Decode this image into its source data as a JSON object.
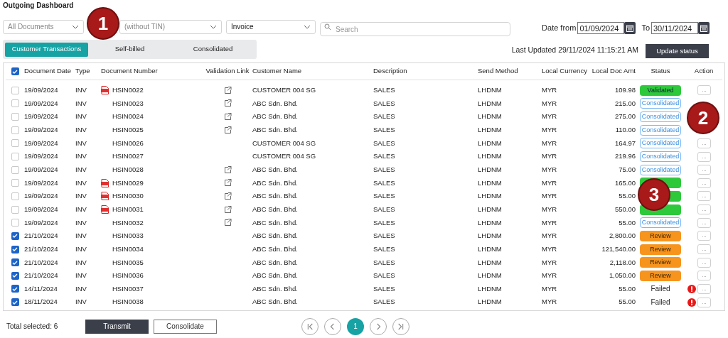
{
  "title": "Outgoing Dashboard",
  "filters": [
    {
      "kind": "dropdown",
      "value": "All Documents",
      "muted": true
    },
    {
      "kind": "dropdown",
      "value": "(without TIN)",
      "muted": true
    },
    {
      "kind": "dropdown",
      "value": "Invoice",
      "muted": false
    },
    {
      "kind": "search",
      "placeholder": "Search"
    }
  ],
  "date_from": {
    "label": "Date from",
    "value": "01/09/2024"
  },
  "date_to": {
    "label": "To",
    "value": "30/11/2024"
  },
  "tabs": [
    {
      "label": "Customer Transactions",
      "selected": true
    },
    {
      "label": "Self-billed",
      "selected": false
    },
    {
      "label": "Consolidated",
      "selected": false
    }
  ],
  "last_updated": "Last Updated 29/11/2024 11:15:21 AM",
  "update_button": "Update status",
  "table": {
    "all_checked": true,
    "columns": [
      "Document Date",
      "Type",
      "Document Number",
      "Validation Link",
      "Customer Name",
      "Description",
      "Send Method",
      "Local Currency",
      "Local Doc Amt",
      "Status",
      "Action"
    ],
    "rows": [
      {
        "checked": false,
        "date": "19/09/2024",
        "type": "INV",
        "pdf": true,
        "number": "HSIN0022",
        "link": true,
        "customer": "CUSTOMER 004 SG",
        "description": "SALES",
        "send": "LHDNM",
        "currency": "MYR",
        "amount": "109.98",
        "status": {
          "kind": "validated",
          "text": "Validated"
        },
        "error": false,
        "action": "..."
      },
      {
        "checked": false,
        "date": "19/09/2024",
        "type": "INV",
        "pdf": false,
        "number": "HSIN0023",
        "link": true,
        "customer": "ABC Sdn. Bhd.",
        "description": "SALES",
        "send": "LHDNM",
        "currency": "MYR",
        "amount": "215.00",
        "status": {
          "kind": "consolidated",
          "text": "Consolidated"
        },
        "error": false
      },
      {
        "checked": false,
        "date": "19/09/2024",
        "type": "INV",
        "pdf": false,
        "number": "HSIN0024",
        "link": true,
        "customer": "ABC Sdn. Bhd.",
        "description": "SALES",
        "send": "LHDNM",
        "currency": "MYR",
        "amount": "275.00",
        "status": {
          "kind": "consolidated",
          "text": "Consolidated"
        },
        "error": false
      },
      {
        "checked": false,
        "date": "19/09/2024",
        "type": "INV",
        "pdf": false,
        "number": "HSIN0025",
        "link": true,
        "customer": "ABC Sdn. Bhd.",
        "description": "SALES",
        "send": "LHDNM",
        "currency": "MYR",
        "amount": "110.00",
        "status": {
          "kind": "consolidated",
          "text": "Consolidated"
        },
        "error": false
      },
      {
        "checked": false,
        "date": "19/09/2024",
        "type": "INV",
        "pdf": false,
        "number": "HSIN0026",
        "link": false,
        "customer": "CUSTOMER 004 SG",
        "description": "SALES",
        "send": "LHDNM",
        "currency": "MYR",
        "amount": "164.97",
        "status": {
          "kind": "consolidated",
          "text": "Consolidated"
        },
        "error": false,
        "action": "..."
      },
      {
        "checked": false,
        "date": "19/09/2024",
        "type": "INV",
        "pdf": false,
        "number": "HSIN0027",
        "link": false,
        "customer": "CUSTOMER 004 SG",
        "description": "SALES",
        "send": "LHDNM",
        "currency": "MYR",
        "amount": "219.96",
        "status": {
          "kind": "consolidated",
          "text": "Consolidated"
        },
        "error": false,
        "action": "..."
      },
      {
        "checked": false,
        "date": "19/09/2024",
        "type": "INV",
        "pdf": false,
        "number": "HSIN0028",
        "link": true,
        "customer": "ABC Sdn. Bhd.",
        "description": "SALES",
        "send": "LHDNM",
        "currency": "MYR",
        "amount": "75.00",
        "status": {
          "kind": "consolidated",
          "text": "Consolidated"
        },
        "error": false,
        "action": "..."
      },
      {
        "checked": false,
        "date": "19/09/2024",
        "type": "INV",
        "pdf": true,
        "number": "HSIN0029",
        "link": true,
        "customer": "ABC Sdn. Bhd.",
        "description": "SALES",
        "send": "LHDNM",
        "currency": "MYR",
        "amount": "165.00",
        "status": {
          "kind": "validated"
        },
        "error": false,
        "action": "..."
      },
      {
        "checked": false,
        "date": "19/09/2024",
        "type": "INV",
        "pdf": true,
        "number": "HSIN0030",
        "link": true,
        "customer": "ABC Sdn. Bhd.",
        "description": "SALES",
        "send": "LHDNM",
        "currency": "MYR",
        "amount": "55.00",
        "status": {
          "kind": "validated"
        },
        "error": false,
        "action": "..."
      },
      {
        "checked": false,
        "date": "19/09/2024",
        "type": "INV",
        "pdf": true,
        "number": "HSIN0031",
        "link": true,
        "customer": "ABC Sdn. Bhd.",
        "description": "SALES",
        "send": "LHDNM",
        "currency": "MYR",
        "amount": "550.00",
        "status": {
          "kind": "validated"
        },
        "error": false,
        "action": "..."
      },
      {
        "checked": false,
        "date": "19/09/2024",
        "type": "INV",
        "pdf": false,
        "number": "HSIN0032",
        "link": true,
        "customer": "ABC Sdn. Bhd.",
        "description": "SALES",
        "send": "LHDNM",
        "currency": "MYR",
        "amount": "55.00",
        "status": {
          "kind": "consolidated",
          "text": "Consolidated"
        },
        "error": false,
        "action": "..."
      },
      {
        "checked": true,
        "date": "21/10/2024",
        "type": "INV",
        "pdf": false,
        "number": "HSIN0033",
        "link": false,
        "customer": "ABC Sdn. Bhd.",
        "description": "SALES",
        "send": "LHDNM",
        "currency": "MYR",
        "amount": "2,800.00",
        "status": {
          "kind": "review",
          "text": "Review"
        },
        "error": false,
        "action": "..."
      },
      {
        "checked": true,
        "date": "21/10/2024",
        "type": "INV",
        "pdf": false,
        "number": "HSIN0034",
        "link": false,
        "customer": "ABC Sdn. Bhd.",
        "description": "SALES",
        "send": "LHDNM",
        "currency": "MYR",
        "amount": "121,540.00",
        "status": {
          "kind": "review",
          "text": "Review"
        },
        "error": false,
        "action": "..."
      },
      {
        "checked": true,
        "date": "21/10/2024",
        "type": "INV",
        "pdf": false,
        "number": "HSIN0035",
        "link": false,
        "customer": "ABC Sdn. Bhd.",
        "description": "SALES",
        "send": "LHDNM",
        "currency": "MYR",
        "amount": "2,118.00",
        "status": {
          "kind": "review",
          "text": "Review"
        },
        "error": false,
        "action": "..."
      },
      {
        "checked": true,
        "date": "21/10/2024",
        "type": "INV",
        "pdf": false,
        "number": "HSIN0036",
        "link": false,
        "customer": "ABC Sdn. Bhd.",
        "description": "SALES",
        "send": "LHDNM",
        "currency": "MYR",
        "amount": "1,050.00",
        "status": {
          "kind": "review",
          "text": "Review"
        },
        "error": false,
        "action": "..."
      },
      {
        "checked": true,
        "date": "14/11/2024",
        "type": "INV",
        "pdf": false,
        "number": "HSIN0037",
        "link": false,
        "customer": "ABC Sdn. Bhd.",
        "description": "SALES",
        "send": "LHDNM",
        "currency": "MYR",
        "amount": "55.00",
        "status": {
          "kind": "failed",
          "text": "Failed"
        },
        "error": true,
        "action": "..."
      },
      {
        "checked": true,
        "date": "18/11/2024",
        "type": "INV",
        "pdf": false,
        "number": "HSIN0038",
        "link": false,
        "customer": "ABC Sdn. Bhd.",
        "description": "SALES",
        "send": "LHDNM",
        "currency": "MYR",
        "amount": "55.00",
        "status": {
          "kind": "failed",
          "text": "Failed"
        },
        "error": true,
        "action": "..."
      }
    ]
  },
  "total_selected": {
    "label": "Total selected:",
    "value": "6"
  },
  "actions": [
    "Transmit",
    "Consolidate"
  ],
  "pagination": [
    {
      "kind": "first"
    },
    {
      "kind": "prev"
    },
    {
      "kind": "page",
      "label": "1",
      "selected": true
    },
    {
      "kind": "next"
    },
    {
      "kind": "last"
    }
  ],
  "callouts": [
    "1",
    "2",
    "3"
  ]
}
